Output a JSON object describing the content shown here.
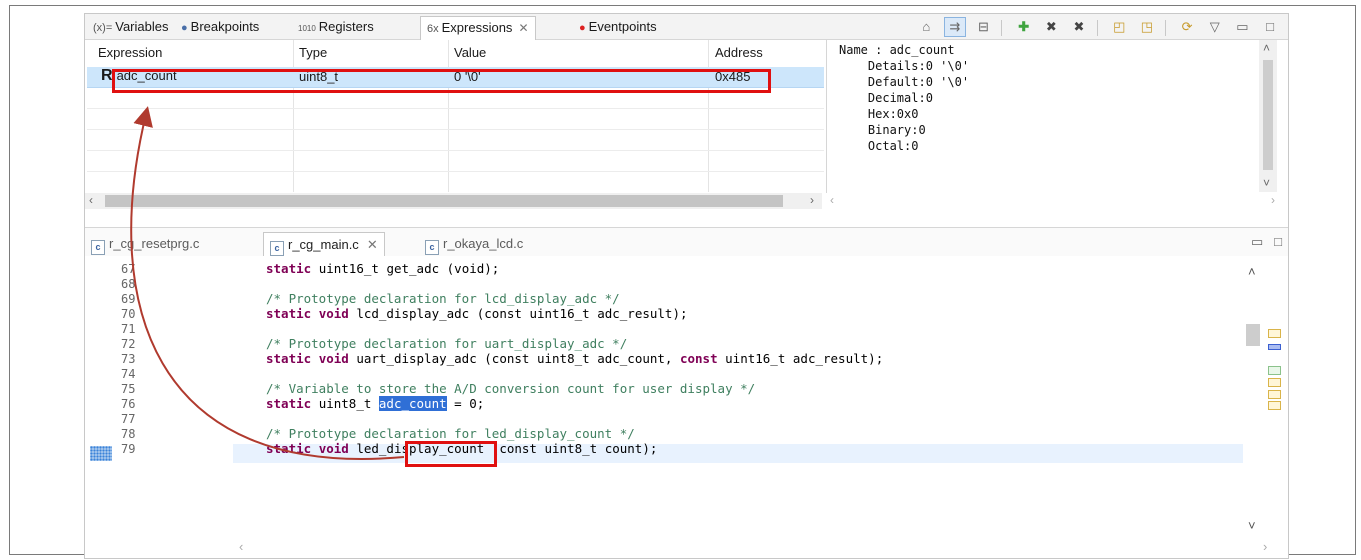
{
  "top_tabs": [
    {
      "icon": "(x)=",
      "label": "Variables"
    },
    {
      "icon": "●",
      "label": "Breakpoints"
    },
    {
      "icon": "1010",
      "label": "Registers"
    },
    {
      "icon": "6x",
      "label": "Expressions",
      "close": "✕"
    },
    {
      "icon": "●",
      "label": "Eventpoints"
    }
  ],
  "expr_table": {
    "headers": [
      "Expression",
      "Type",
      "Value",
      "Address"
    ],
    "rows": [
      {
        "marker": "R",
        "expression": "adc_count",
        "type": "uint8_t",
        "value": "0 '\\0'",
        "address": "0x485"
      }
    ]
  },
  "details_text": "Name : adc_count\n    Details:0 '\\0'\n    Default:0 '\\0'\n    Decimal:0\n    Hex:0x0\n    Binary:0\n    Octal:0",
  "editor_tabs": [
    {
      "label": "r_cg_resetprg.c"
    },
    {
      "label": "r_cg_main.c",
      "close": "✕"
    },
    {
      "label": "r_okaya_lcd.c"
    }
  ],
  "code_lines": [
    {
      "n": "67",
      "text": "static uint16_t get_adc (void);"
    },
    {
      "n": "68",
      "text": ""
    },
    {
      "n": "69",
      "text": "/* Prototype declaration for lcd_display_adc */"
    },
    {
      "n": "70",
      "text": "static void lcd_display_adc (const uint16_t adc_result);"
    },
    {
      "n": "71",
      "text": ""
    },
    {
      "n": "72",
      "text": "/* Prototype declaration for uart_display_adc */"
    },
    {
      "n": "73",
      "text": "static void uart_display_adc (const uint8_t adc_count, const uint16_t adc_result);"
    },
    {
      "n": "74",
      "text": ""
    },
    {
      "n": "75",
      "text": "/* Variable to store the A/D conversion count for user display */"
    },
    {
      "n": "76",
      "text": "static uint8_t adc_count = 0;"
    },
    {
      "n": "77",
      "text": ""
    },
    {
      "n": "78",
      "text": "/* Prototype declaration for led_display_count */"
    },
    {
      "n": "79",
      "text": "static void led_display_count (const uint8_t count);"
    }
  ],
  "colors": {
    "highlight": "#e01010",
    "selection": "#cde6fb",
    "arrow": "#b03a2e",
    "comment": "#3f7f5f",
    "keyword": "#7f0055"
  }
}
